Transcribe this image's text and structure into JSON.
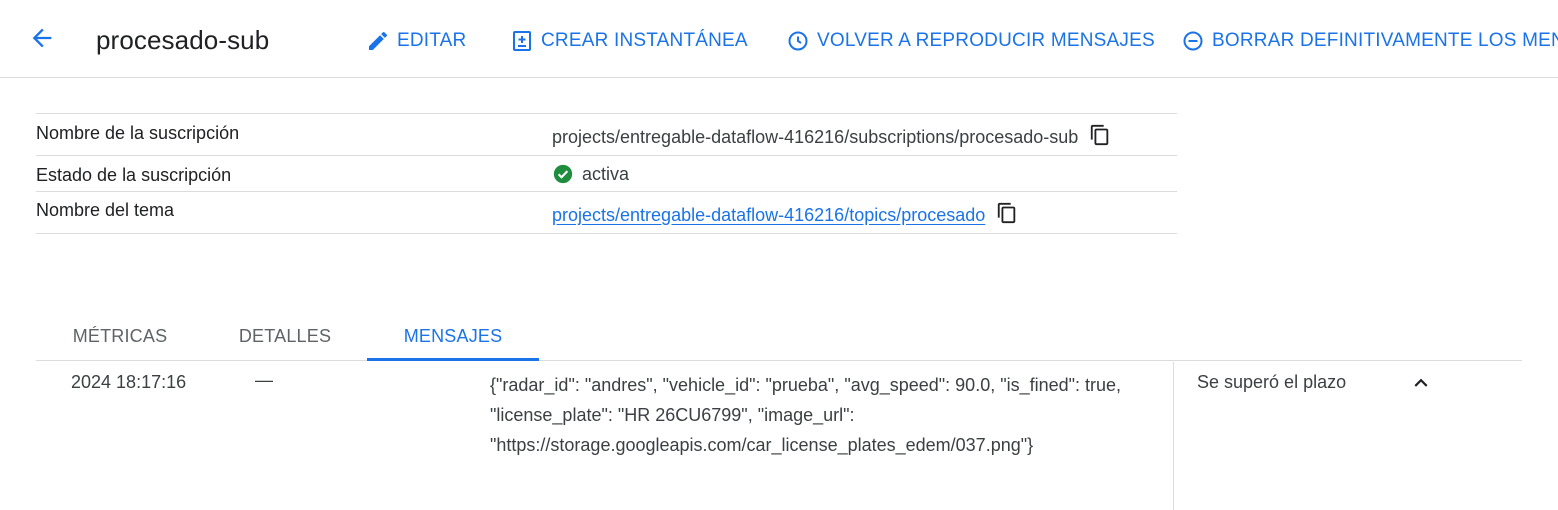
{
  "header": {
    "back_icon": "arrow-back-icon",
    "title": "procesado-sub",
    "actions": [
      {
        "label": "EDITAR",
        "icon": "edit-pencil-icon"
      },
      {
        "label": "CREAR INSTANTÁNEA",
        "icon": "add-snapshot-icon"
      },
      {
        "label": "VOLVER A REPRODUCIR MENSAJES",
        "icon": "history-clock-icon"
      },
      {
        "label": "BORRAR DEFINITIVAMENTE LOS MENSAJES",
        "icon": "remove-circle-icon"
      }
    ],
    "accent_color": "#1a73e8"
  },
  "details": {
    "rows": [
      {
        "label": "Nombre de la suscripción",
        "value": "projects/entregable-dataflow-416216/subscriptions/procesado-sub",
        "icon": "copy-icon"
      },
      {
        "label": "Estado de la suscripción",
        "value": "activa",
        "icon": "check-circle-icon",
        "status_color": "#1e8e3e"
      },
      {
        "label": "Nombre del tema",
        "value": "projects/entregable-dataflow-416216/topics/procesado",
        "icon": "copy-icon"
      }
    ]
  },
  "tabs": [
    {
      "label": "MÉTRICAS",
      "active": false
    },
    {
      "label": "DETALLES",
      "active": false
    },
    {
      "label": "MENSAJES",
      "active": true
    }
  ],
  "messages": [
    {
      "time": "2024 18:17:16",
      "attributes": "—",
      "body_lines": [
        "{\"radar_id\": \"andres\", \"vehicle_id\": \"prueba\", \"avg_speed\": 90.0, \"is_fined\": true,",
        "\"license_plate\": \"HR 26CU6799\", \"image_url\":",
        "\"https://storage.googleapis.com/car_license_plates_edem/037.png\"}"
      ],
      "ack_status": "Se superó el plazo",
      "toggle_icon": "chevron-up-icon"
    }
  ]
}
